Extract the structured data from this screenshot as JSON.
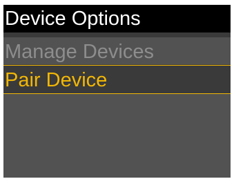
{
  "header": {
    "title": "Device Options"
  },
  "menu": {
    "items": [
      {
        "label": "Manage Devices",
        "state": "disabled"
      },
      {
        "label": "Pair Device",
        "state": "selected"
      }
    ]
  },
  "colors": {
    "title_bg": "#000000",
    "title_text": "#ffffff",
    "screen_bg": "#525252",
    "disabled_text": "#8d8d8d",
    "selected_accent": "#f2b705"
  }
}
